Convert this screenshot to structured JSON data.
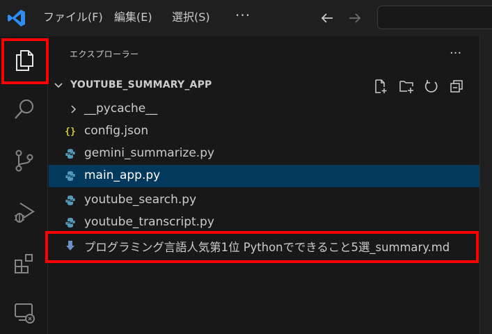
{
  "menu": {
    "file": "ファイル(F)",
    "edit": "編集(E)",
    "selection": "選択(S)",
    "more": "···"
  },
  "sidebar": {
    "title": "エクスプローラー",
    "more": "···",
    "folder": {
      "name": "YOUTUBE_SUMMARY_APP"
    },
    "items": [
      {
        "label": "__pycache__",
        "type": "folder",
        "icon": "chevron-right-icon"
      },
      {
        "label": "config.json",
        "type": "json",
        "icon": "json-file-icon",
        "icon_glyph": "{}"
      },
      {
        "label": "gemini_summarize.py",
        "type": "python",
        "icon": "python-file-icon"
      },
      {
        "label": "main_app.py",
        "type": "python",
        "icon": "python-file-icon",
        "selected": true
      },
      {
        "label": "youtube_search.py",
        "type": "python",
        "icon": "python-file-icon"
      },
      {
        "label": "youtube_transcript.py",
        "type": "python",
        "icon": "python-file-icon"
      },
      {
        "label": "プログラミング言語人気第1位 Pythonでできること5選_summary.md",
        "type": "markdown",
        "icon": "markdown-download-icon",
        "highlighted": true
      }
    ]
  },
  "colors": {
    "accent": "#0078d4",
    "selection": "#04395e",
    "highlight_border": "#ff0000",
    "python_icon": "#519aba",
    "json_icon": "#cbcb41"
  }
}
